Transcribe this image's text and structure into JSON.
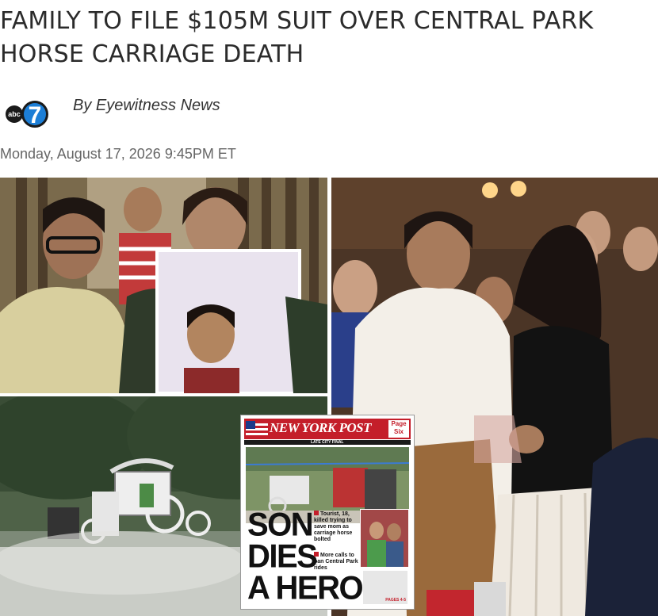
{
  "article": {
    "headline": "FAMILY TO FILE $105M SUIT OVER CENTRAL PARK HORSE CARRIAGE DEATH",
    "byline": "By Eyewitness News",
    "date": "Monday, August 17, 2026 9:45PM ET"
  },
  "logo": {
    "text": "abc",
    "number": "7",
    "icon": "abc7-logo"
  },
  "newspaper": {
    "masthead": "NEW YORK POST",
    "page_label": "Page Six",
    "edition": "LATE CITY FINAL",
    "headline_lines": [
      "SON",
      "DIES",
      "A HERO"
    ],
    "bullet_1": "Tourist, 18, killed trying to save mom as carriage horse bolted",
    "bullet_2": "More calls to ban Central Park rides",
    "ad_tag": "PAGES 4-5"
  },
  "colors": {
    "post_red": "#c41e2a",
    "headline": "#2b2b2b",
    "date": "#666666"
  }
}
